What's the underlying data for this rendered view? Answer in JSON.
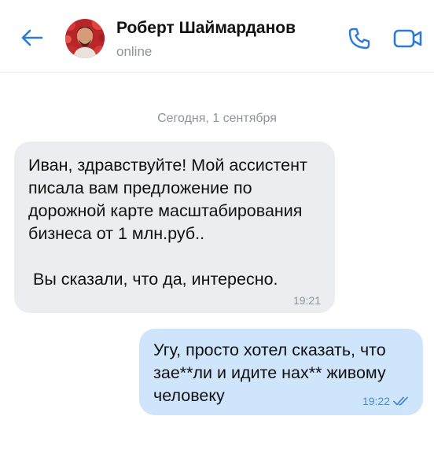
{
  "header": {
    "contact_name": "Роберт Шаймарданов",
    "status": "online"
  },
  "chat": {
    "date_separator": "Сегодня, 1 сентября",
    "messages": [
      {
        "direction": "incoming",
        "text": "Иван, здравствуйте! Мой ассистент\nписала вам предложение по\nдорожной карте масштабирования\nбизнеса от 1 млн.руб..\n\n Вы сказали, что да, интересно.",
        "time": "19:21"
      },
      {
        "direction": "outgoing",
        "text": "Угу, просто хотел сказать, что\nзае**ли и идите нах** живому\nчеловеку",
        "time": "19:22",
        "read_receipt": "double-check-icon"
      }
    ]
  },
  "colors": {
    "accent": "#2b7ad6",
    "incoming_bubble": "#ebedf0",
    "outgoing_bubble": "#cfe5fb",
    "secondary_text": "#8e949c"
  }
}
